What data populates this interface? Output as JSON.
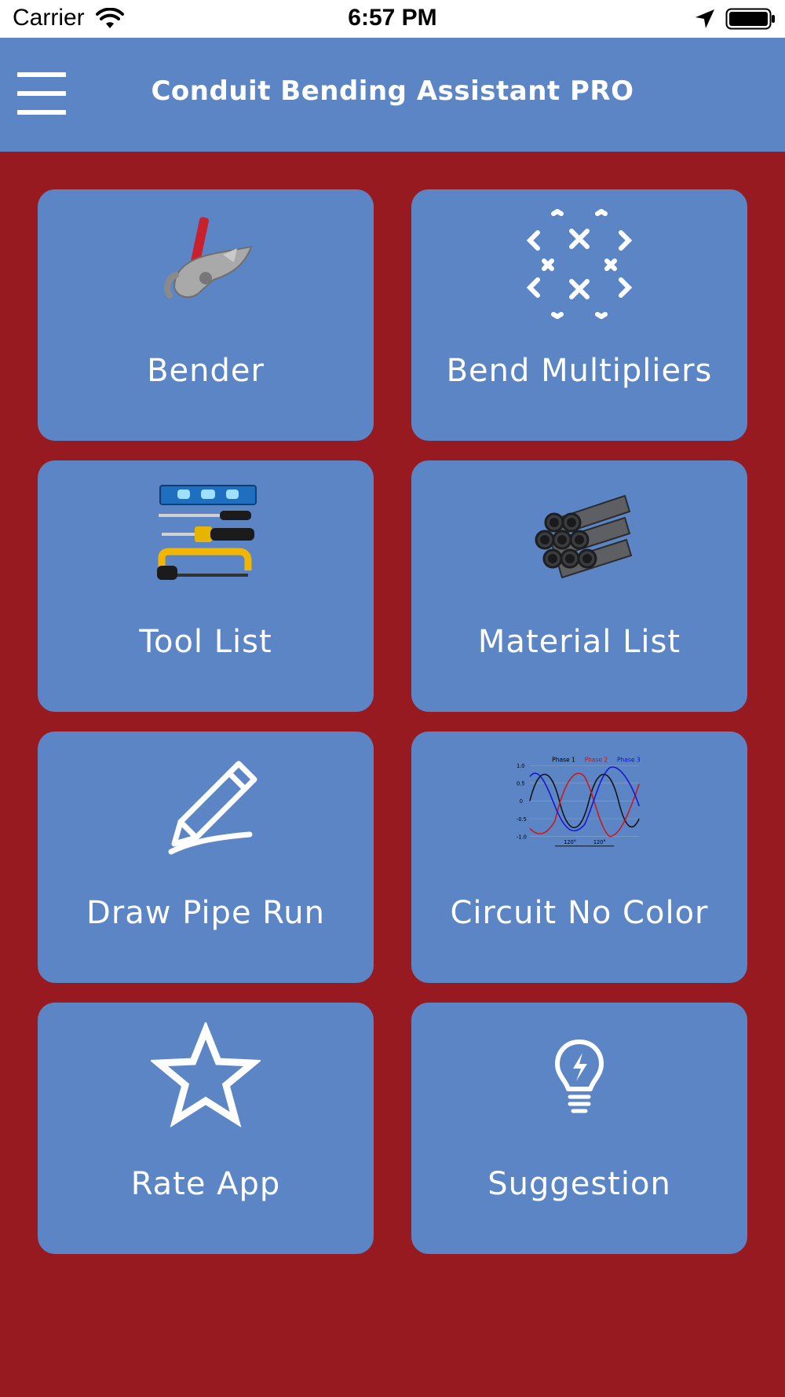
{
  "status_bar": {
    "carrier": "Carrier",
    "time": "6:57 PM"
  },
  "header": {
    "title": "Conduit Bending Assistant PRO"
  },
  "tiles": [
    {
      "label": "Bender",
      "icon": "pipe-bender-icon"
    },
    {
      "label": "Bend Multipliers",
      "icon": "bend-multipliers-icon"
    },
    {
      "label": "Tool List",
      "icon": "tools-icon"
    },
    {
      "label": "Material List",
      "icon": "pipes-icon"
    },
    {
      "label": "Draw Pipe Run",
      "icon": "pencil-icon"
    },
    {
      "label": "Circuit No Color",
      "icon": "phase-wave-chart-icon",
      "chart_labels": [
        "Phase 1",
        "Phase 2",
        "Phase 3"
      ],
      "chart_ticks": [
        "1.0",
        "0.5",
        "0",
        "-0.5",
        "-1.0"
      ],
      "chart_angles": [
        "120°",
        "120°"
      ]
    },
    {
      "label": "Rate App",
      "icon": "star-icon"
    },
    {
      "label": "Suggestion",
      "icon": "lightbulb-icon"
    }
  ],
  "colors": {
    "background": "#971a21",
    "accent": "#5b85c4",
    "text": "#ffffff"
  }
}
